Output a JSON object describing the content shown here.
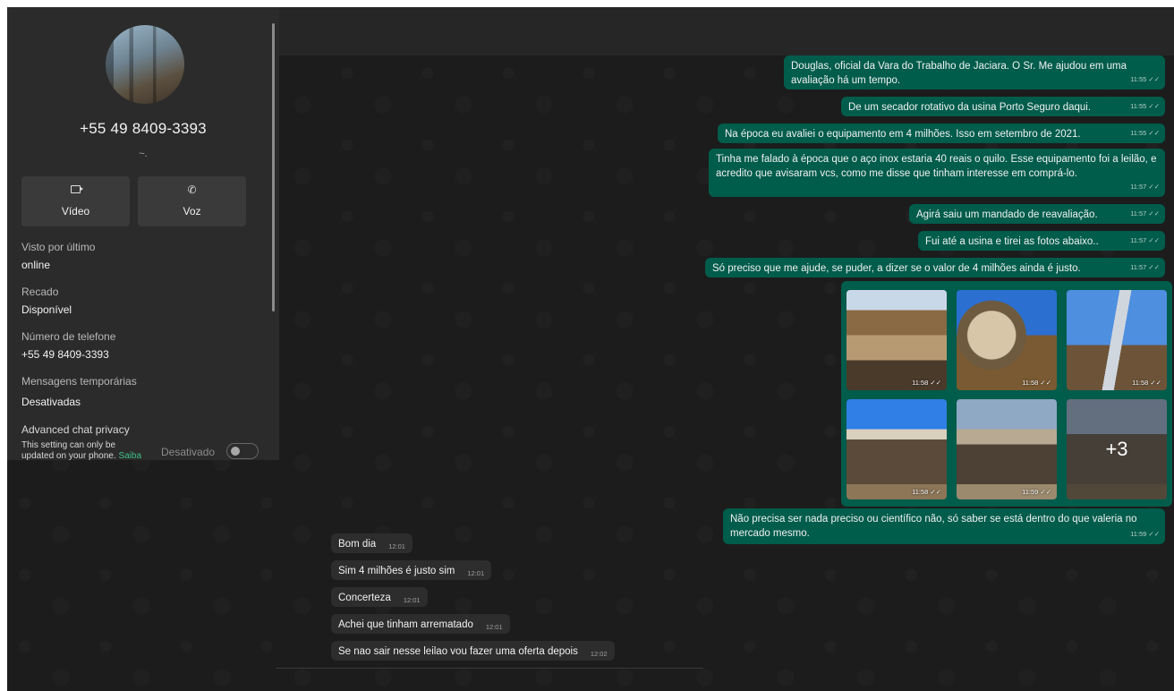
{
  "contact": {
    "phone_title": "+55 49 8409-3393",
    "about_short": "~.",
    "video_label": "Vídeo",
    "voice_label": "Voz",
    "video_icon": "video-camera-icon",
    "voice_icon": "phone-icon",
    "last_seen_label": "Visto por último",
    "last_seen_value": "online",
    "about_label": "Recado",
    "about_value": "Disponível",
    "phone_label": "Número de telefone",
    "phone_value": "+55 49 8409-3393",
    "temp_label": "Mensagens temporárias",
    "temp_value": "Desativadas",
    "privacy_label": "Advanced chat privacy",
    "privacy_note": "This setting can only be updated on your phone.",
    "privacy_link": "Saiba",
    "privacy_state": "Desativado"
  },
  "colors": {
    "outgoing_bubble": "#005c4b",
    "incoming_bubble": "#2d2d2d",
    "background": "#1c1c1c",
    "link": "#3fbf8a"
  },
  "outgoing": [
    {
      "text": "Douglas, oficial da Vara do Trabalho de Jaciara. O Sr. Me ajudou em uma avaliação há um tempo.",
      "time": "11:55"
    },
    {
      "text": "De um secador rotativo da usina Porto Seguro daqui.",
      "time": "11:55"
    },
    {
      "text": "Na época eu avaliei o equipamento em 4 milhões. Isso em setembro de 2021.",
      "time": "11:55"
    },
    {
      "text": "Tinha me falado à época que o aço inox estaria 40 reais o quilo. Esse equipamento foi a leilão, e acredito que avisaram vcs, como me disse que tinham interesse em comprá-lo.",
      "time": "11:57"
    },
    {
      "text": "Agirá saiu um mandado de reavaliação.",
      "time": "11:57"
    },
    {
      "text": "Fui até a usina e tirei as fotos abaixo..",
      "time": "11:57"
    },
    {
      "text": "Só preciso que me ajude, se puder, a dizer se o valor de 4 milhões ainda é justo.",
      "time": "11:57"
    },
    {
      "text": "Não precisa ser nada preciso ou científico não, só saber se está dentro do que valeria no mercado mesmo.",
      "time": "11:59"
    }
  ],
  "photos": [
    {
      "time": "11:58"
    },
    {
      "time": "11:58"
    },
    {
      "time": "11:58"
    },
    {
      "time": "11:58"
    },
    {
      "time": "11:59"
    },
    {
      "time": "",
      "more": "+3"
    }
  ],
  "incoming": [
    {
      "text": "Bom dia",
      "time": "12:01"
    },
    {
      "text": "Sim 4 milhões é justo sim",
      "time": "12:01"
    },
    {
      "text": "Concerteza",
      "time": "12:01"
    },
    {
      "text": "Achei que tinham arrematado",
      "time": "12:01"
    },
    {
      "text": "Se nao sair nesse leilao vou fazer uma oferta depois",
      "time": "12:02"
    }
  ]
}
